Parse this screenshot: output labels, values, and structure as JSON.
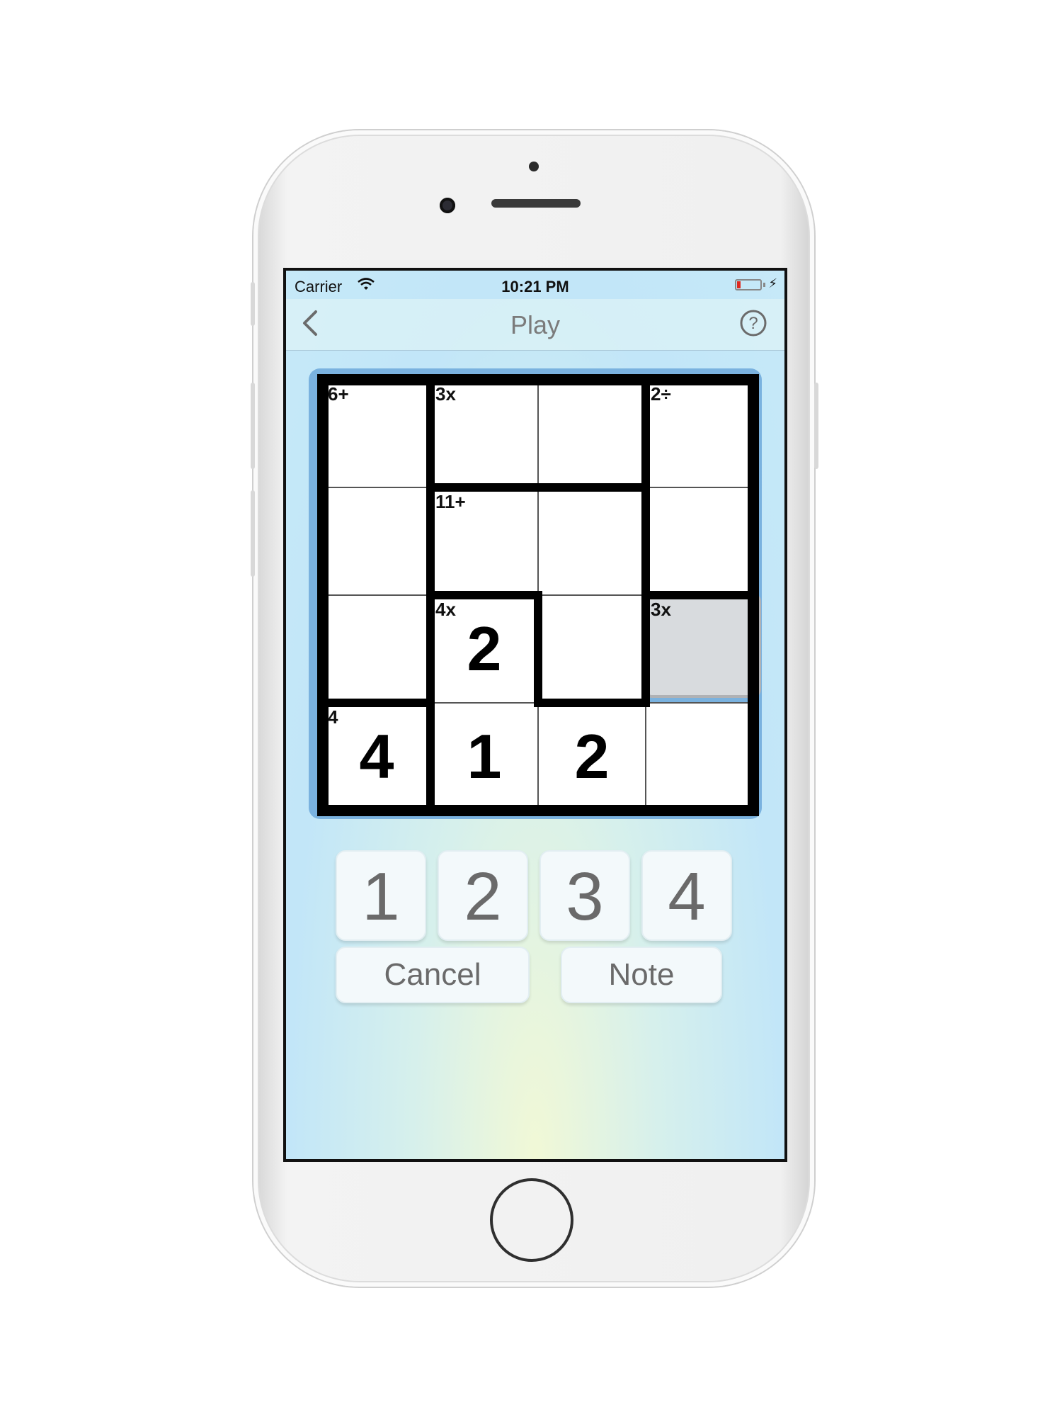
{
  "status_bar": {
    "carrier": "Carrier",
    "time": "10:21 PM",
    "battery_color": "#e0281e",
    "wifi_icon": "wifi-icon",
    "charging_icon": "bolt-icon"
  },
  "nav": {
    "title": "Play",
    "back_icon": "chevron-left-icon",
    "help_icon": "question-circle-icon"
  },
  "puzzle": {
    "size": 4,
    "clues": {
      "r0c0": "6+",
      "r0c1": "3x",
      "r0c3": "2÷",
      "r1c1": "11+",
      "r2c1": "4x",
      "r2c3": "3x",
      "r3c0": "4"
    },
    "values": {
      "r2c1": "2",
      "r3c0": "4",
      "r3c1": "1",
      "r3c2": "2"
    },
    "selected_cell": "r2c3"
  },
  "keypad": {
    "keys": [
      "1",
      "2",
      "3",
      "4"
    ],
    "cancel_label": "Cancel",
    "note_label": "Note"
  },
  "colors": {
    "board_frame": "#7ab2df",
    "key_text": "#6a6a6a",
    "title_text": "#7b7b7b"
  }
}
